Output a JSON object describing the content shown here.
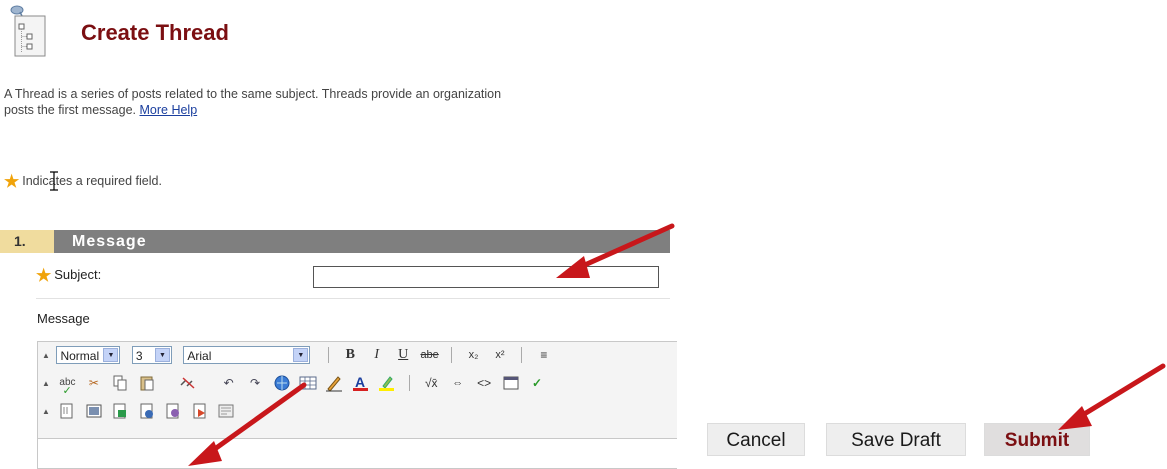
{
  "header": {
    "title": "Create Thread"
  },
  "description": {
    "text": "A Thread is a series of posts related to the same subject. Threads provide an organization",
    "text2": "posts the first message.",
    "help_link": "More Help"
  },
  "required_note": {
    "star": "★",
    "text": "Indicates a required field."
  },
  "section": {
    "number": "1.",
    "title": "Message"
  },
  "subject": {
    "star": "★",
    "label": "Subject:",
    "value": ""
  },
  "message": {
    "label": "Message"
  },
  "editor": {
    "style_value": "Normal",
    "size_value": "3",
    "font_value": "Arial",
    "bold_label": "B",
    "italic_label": "I",
    "underline_label": "U",
    "strike_label": "abe",
    "subscript_label": "x₂",
    "superscript_label": "x²",
    "spell_label": "abc",
    "toolbar_icons_row2": [
      "spellcheck-icon",
      "cut-icon",
      "copy-icon",
      "paste-icon",
      "remove-link-icon",
      "undo-icon",
      "redo-icon",
      "link-icon",
      "table-icon",
      "pencil-icon",
      "font-color-icon",
      "highlight-icon",
      "math-icon",
      "link-object-icon",
      "html-icon",
      "preview-icon",
      "check-icon"
    ],
    "toolbar_icons_row3": [
      "attach-file-icon",
      "insert-image-icon",
      "insert-media-icon",
      "insert-audio-icon",
      "insert-flash-icon",
      "insert-powerpoint-icon",
      "insert-template-icon"
    ]
  },
  "actions": {
    "cancel_label": "Cancel",
    "save_draft_label": "Save Draft",
    "submit_label": "Submit"
  },
  "colors": {
    "title": "#7b0f12",
    "section_header": "#7f7f7f",
    "step_badge": "#f0dc9e",
    "required_star": "#f0a30a",
    "arrow": "#c8171b"
  }
}
